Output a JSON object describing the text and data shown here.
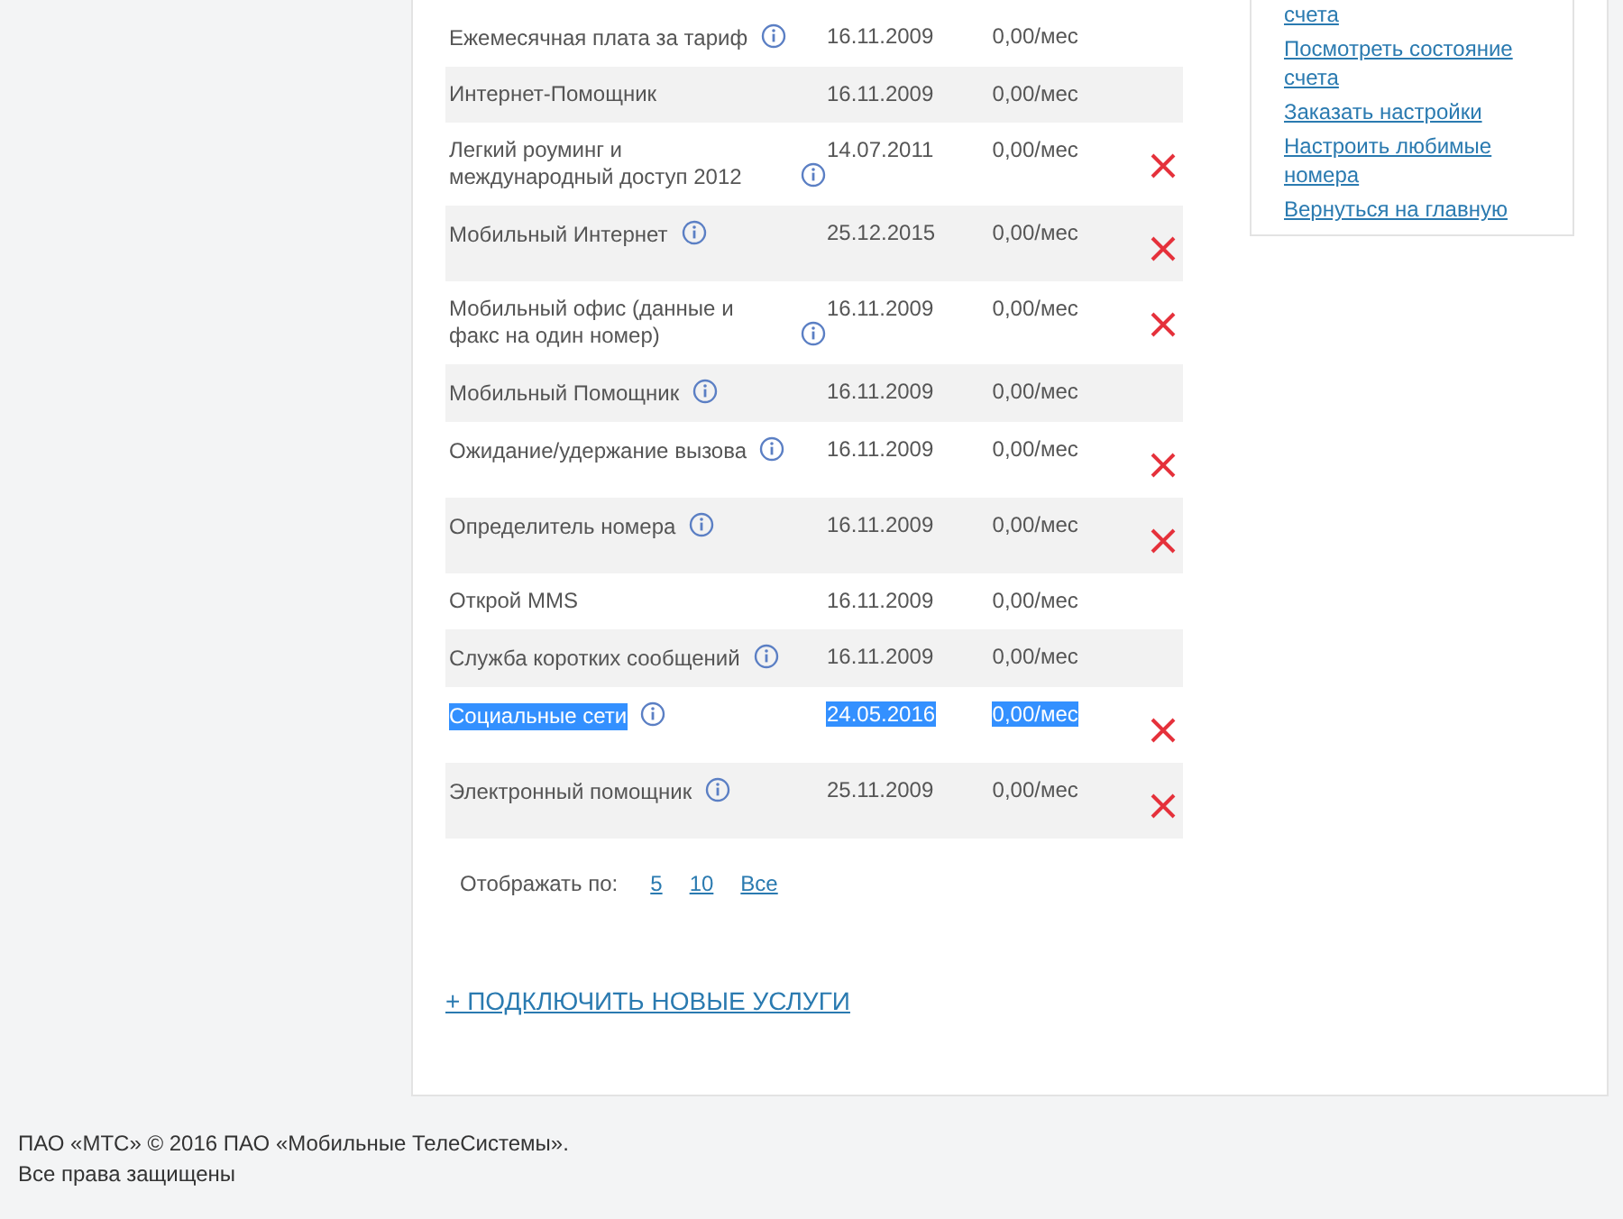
{
  "services": [
    {
      "name": "Ежемесячная плата за тариф",
      "info": true,
      "date": "16.11.2009",
      "price": "0,00/мес",
      "removable": false,
      "highlighted": false
    },
    {
      "name": "Интернет-Помощник",
      "info": false,
      "date": "16.11.2009",
      "price": "0,00/мес",
      "removable": false,
      "highlighted": false
    },
    {
      "name": "Легкий роуминг и международный доступ 2012",
      "info": true,
      "date": "14.07.2011",
      "price": "0,00/мес",
      "removable": true,
      "highlighted": false
    },
    {
      "name": "Мобильный Интернет",
      "info": true,
      "date": "25.12.2015",
      "price": "0,00/мес",
      "removable": true,
      "highlighted": false
    },
    {
      "name": "Мобильный офис (данные и факс на один номер)",
      "info": true,
      "date": "16.11.2009",
      "price": "0,00/мес",
      "removable": true,
      "highlighted": false
    },
    {
      "name": "Мобильный Помощник",
      "info": true,
      "date": "16.11.2009",
      "price": "0,00/мес",
      "removable": false,
      "highlighted": false
    },
    {
      "name": "Ожидание/удержание вызова",
      "info": true,
      "date": "16.11.2009",
      "price": "0,00/мес",
      "removable": true,
      "highlighted": false
    },
    {
      "name": "Определитель номера",
      "info": true,
      "date": "16.11.2009",
      "price": "0,00/мес",
      "removable": true,
      "highlighted": false
    },
    {
      "name": "Открой MMS",
      "info": false,
      "date": "16.11.2009",
      "price": "0,00/мес",
      "removable": false,
      "highlighted": false
    },
    {
      "name": "Служба коротких сообщений",
      "info": true,
      "date": "16.11.2009",
      "price": "0,00/мес",
      "removable": false,
      "highlighted": false
    },
    {
      "name": "Социальные сети",
      "info": true,
      "date": "24.05.2016",
      "price": "0,00/мес",
      "removable": true,
      "highlighted": true
    },
    {
      "name": "Электронный помощник",
      "info": true,
      "date": "25.11.2009",
      "price": "0,00/мес",
      "removable": true,
      "highlighted": false
    }
  ],
  "pager": {
    "label": "Отображать по:",
    "options": [
      "5",
      "10",
      "Все"
    ]
  },
  "add_link": "+ ПОДКЛЮЧИТЬ НОВЫЕ УСЛУГИ",
  "sidebar": {
    "links": [
      "счета",
      "Посмотреть состояние счета",
      "Заказать настройки",
      "Настроить любимые номера",
      "Вернуться на главную"
    ]
  },
  "footer": [
    "ПАО «МТС» © 2016 ПАО «Мобильные ТелеСистемы».",
    "Все права защищены"
  ]
}
